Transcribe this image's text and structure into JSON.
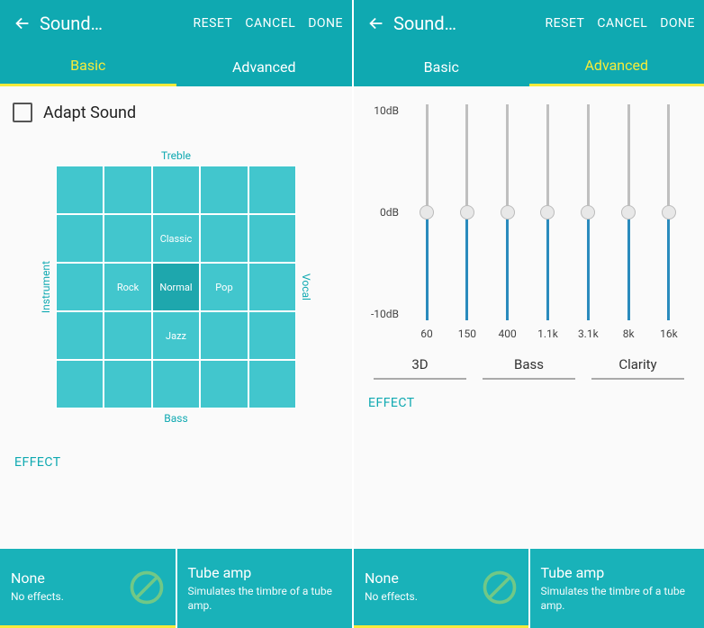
{
  "header": {
    "title": "Sound…",
    "reset": "RESET",
    "cancel": "CANCEL",
    "done": "DONE",
    "tab_basic": "Basic",
    "tab_advanced": "Advanced"
  },
  "basic": {
    "adapt_label": "Adapt Sound",
    "axis": {
      "top": "Treble",
      "bottom": "Bass",
      "left": "Instrument",
      "right": "Vocal"
    },
    "presets": {
      "classic": "Classic",
      "rock": "Rock",
      "normal": "Normal",
      "pop": "Pop",
      "jazz": "Jazz"
    }
  },
  "advanced": {
    "db_top": "10dB",
    "db_mid": "0dB",
    "db_bot": "-10dB",
    "freqs": [
      "60",
      "150",
      "400",
      "1.1k",
      "3.1k",
      "8k",
      "16k"
    ],
    "extras": {
      "three_d": "3D",
      "bass": "Bass",
      "clarity": "Clarity"
    }
  },
  "effect": {
    "label": "EFFECT",
    "none_title": "None",
    "none_desc": "No effects.",
    "tube_title": "Tube amp",
    "tube_desc": "Simulates the timbre of a tube amp."
  }
}
